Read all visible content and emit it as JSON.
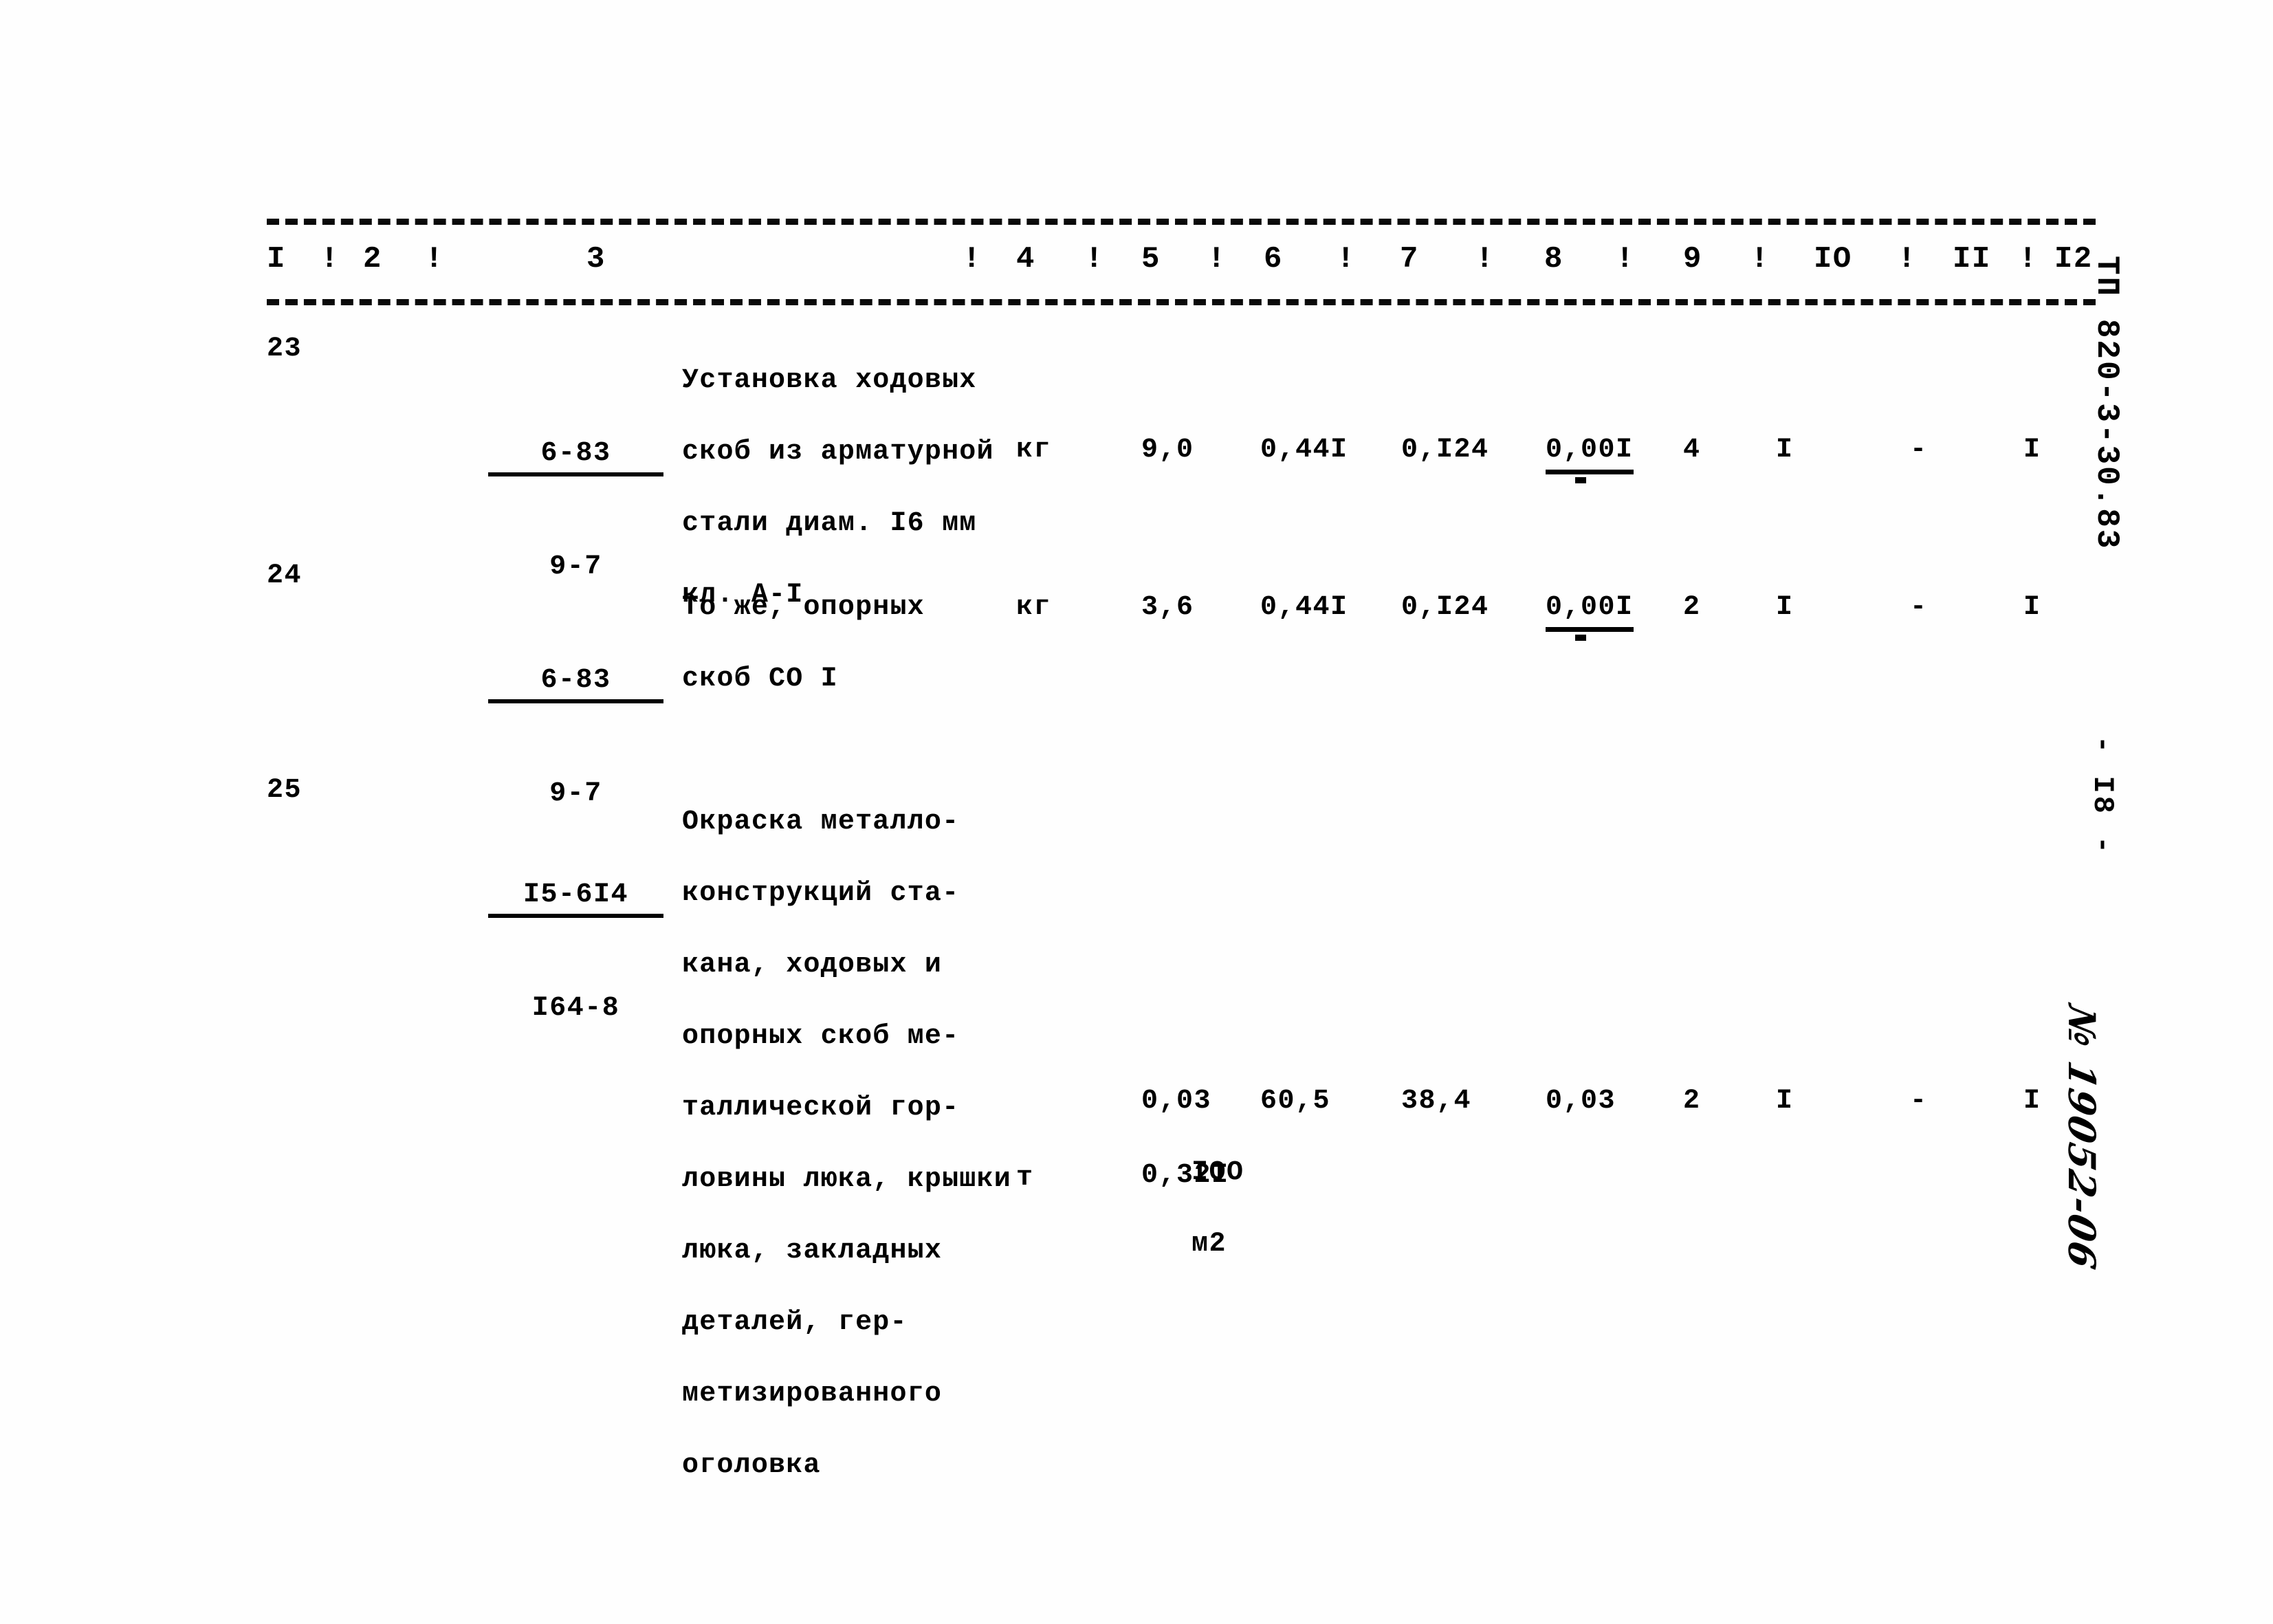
{
  "document": {
    "doc_code": "ТП 820-3-30.83",
    "page_number": "- I8 -",
    "hand_note": "№ 19052-06"
  },
  "table": {
    "column_headers": [
      "I",
      "2",
      "3",
      "4",
      "5",
      "6",
      "7",
      "8",
      "9",
      "IO",
      "II",
      "I2"
    ],
    "separator": "!",
    "rows": [
      {
        "number": "23",
        "code_top": "6-83",
        "code_bottom": "9-7",
        "description": [
          "Установка ходовых",
          "скоб из арматурной",
          "стали диам. I6 мм",
          "кл. А-I"
        ],
        "unit": "кг",
        "c5": "9,0",
        "c6": "0,44I",
        "c7": "0,I24",
        "c8": "0,00I",
        "c9": "4",
        "c10": "I",
        "c11": "-",
        "c12": "I"
      },
      {
        "number": "24",
        "code_top": "6-83",
        "code_bottom": "9-7",
        "description": [
          "То же, опорных",
          "скоб СО I"
        ],
        "unit": "кг",
        "c5": "3,6",
        "c6": "0,44I",
        "c7": "0,I24",
        "c8": "0,00I",
        "c9": "2",
        "c10": "I",
        "c11": "-",
        "c12": "I"
      },
      {
        "number": "25",
        "code_top": "I5-6I4",
        "code_bottom": "I64-8",
        "description": [
          "Окраска металло-",
          "конструкций ста-",
          "кана, ходовых и",
          "опорных скоб ме-",
          "таллической гор-",
          "ловины люка, крышки",
          "люка, закладных",
          "деталей, гер-",
          "метизированного",
          "оголовка"
        ],
        "unit_line1": "IOO",
        "unit_line2": "м2",
        "unit_line3": "т",
        "c5": "0,03",
        "c6": "60,5",
        "c7": "38,4",
        "c8": "0,03",
        "c9": "2",
        "c10": "I",
        "c11": "-",
        "c12": "I",
        "c5_second": "0,32I"
      }
    ]
  }
}
